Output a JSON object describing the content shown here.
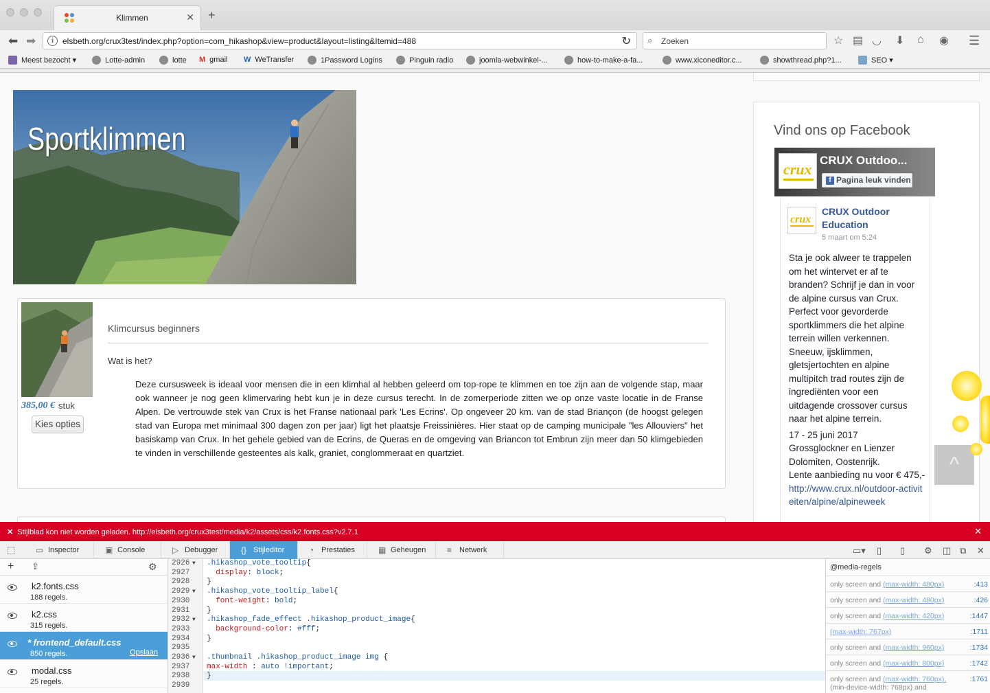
{
  "browser": {
    "tab_title": "Klimmen",
    "url": "elsbeth.org/crux3test/index.php?option=com_hikashop&view=product&layout=listing&Itemid=488",
    "search_placeholder": "Zoeken",
    "bookmarks": [
      {
        "label": "Meest bezocht",
        "icon": "folder-icon"
      },
      {
        "label": "Lotte-admin",
        "icon": "globe-icon"
      },
      {
        "label": "lotte",
        "icon": "globe-icon"
      },
      {
        "label": "gmail",
        "icon": "gmail-icon"
      },
      {
        "label": "WeTransfer",
        "icon": "wetransfer-icon"
      },
      {
        "label": "1Password Logins",
        "icon": "globe-icon"
      },
      {
        "label": "Pinguin radio",
        "icon": "globe-icon"
      },
      {
        "label": "joomla-webwinkel-...",
        "icon": "globe-icon"
      },
      {
        "label": "how-to-make-a-fa...",
        "icon": "globe-icon"
      },
      {
        "label": "www.xiconeditor.c...",
        "icon": "globe-icon"
      },
      {
        "label": "showthread.php?1...",
        "icon": "globe-icon"
      },
      {
        "label": "SEO",
        "icon": "folder-icon"
      }
    ]
  },
  "page": {
    "hero_title": "Sportklimmen",
    "product": {
      "title": "Klimcursus beginners",
      "subtitle": "Wat is het?",
      "price": "385,00 €",
      "price_unit": "stuk",
      "button": "Kies opties",
      "body": "Deze cursusweek is ideaal voor mensen die in een klimhal al hebben geleerd om top-rope te klimmen en toe zijn aan de volgende stap, maar ook wanneer je nog geen klimervaring hebt kun je in deze cursus terecht. In de zomerperiode zitten we op onze vaste locatie in de Franse Alpen. De vertrouwde stek van Crux is het Franse nationaal park 'Les Ecrins'. Op ongeveer 20 km. van de stad Briançon (de hoogst gelegen stad van Europa met minimaal 300 dagen zon per jaar) ligt het plaatsje Freissinières. Hier staat op de camping municipale \"les Allouviers\" het basiskamp van Crux. In het gehele gebied van de Ecrins, de Queras en de omgeving van Briancon tot Embrun zijn meer dan 50 klimgebieden te vinden in verschillende gesteentes als kalk, graniet, conglommeraat en quartziet."
    },
    "facebook": {
      "heading": "Vind ons op Facebook",
      "page_name": "CRUX Outdoo...",
      "like_button": "Pagina leuk vinden",
      "post_author": "CRUX Outdoor Education",
      "post_date": "5 maart om 5:24",
      "post_text_1": "Sta je ook alweer te trappelen om het wintervet er af te branden? Schrijf je dan in voor de alpine cursus van Crux. Perfect voor gevorderde sportklimmers die het alpine terrein willen verkennen. Sneeuw, ijsklimmen, gletsjertochten en alpine multipitch trad routes zijn de ingrediënten voor een uitdagende crossover cursus naar het alpine terrein.",
      "post_text_2": "17 - 25 juni 2017",
      "post_text_3": "Grossglockner en Lienzer Dolomiten, Oostenrijk.",
      "post_text_4": "Lente aanbieding nu voor € 475,-",
      "post_link": "http://www.crux.nl/outdoor-activiteiten/alpine/alpineweek"
    },
    "scroll_top": "^"
  },
  "devtools": {
    "error": "Stijlblad kon niet worden geladen. http://elsbeth.org/crux3test/media/k2/assets/css/k2.fonts.css?v2.7.1",
    "tabs": [
      "Inspector",
      "Console",
      "Debugger",
      "Stijleditor",
      "Prestaties",
      "Geheugen",
      "Netwerk"
    ],
    "active_tab": "Stijleditor",
    "stylesheets": [
      {
        "name": "k2.fonts.css",
        "rules": "188 regels."
      },
      {
        "name": "k2.css",
        "rules": "315 regels."
      },
      {
        "name": "* frontend_default.css",
        "rules": "850 regels.",
        "action": "Opslaan"
      },
      {
        "name": "modal.css",
        "rules": "25 regels."
      }
    ],
    "line_numbers": [
      "2926",
      "2927",
      "2928",
      "2929",
      "2930",
      "2931",
      "2932",
      "2933",
      "2934",
      "2935",
      "2936",
      "2937",
      "2938",
      "2939"
    ],
    "code": [
      ".hikashop_vote_tooltip{",
      "  display: block;",
      "}",
      ".hikashop_vote_tooltip_label{",
      "  font-weight: bold;",
      "}",
      ".hikashop_fade_effect .hikashop_product_image{",
      "  background-color: #fff;",
      "}",
      "",
      ".thumbnail .hikashop_product_image img {",
      "max-width : auto !important;",
      "}",
      ""
    ],
    "media_heading": "@media-regels",
    "media_rules": [
      {
        "prefix": "only screen and ",
        "query": "(max-width: 480px)",
        "line": ":413"
      },
      {
        "prefix": "only screen and ",
        "query": "(max-width: 480px)",
        "line": ":426"
      },
      {
        "prefix": "only screen and ",
        "query": "(max-width: 420px)",
        "line": ":1447"
      },
      {
        "prefix": "",
        "query": "(max-width: 767px)",
        "line": ":1711"
      },
      {
        "prefix": "only screen and ",
        "query": "(max-width: 960px)",
        "line": ":1734"
      },
      {
        "prefix": "only screen and ",
        "query": "(max-width: 800px)",
        "line": ":1742"
      },
      {
        "prefix": "only screen and ",
        "query": "(max-width: 760px),",
        "line": ":1761",
        "extra": "(min-device-width: 768px) and"
      }
    ]
  }
}
